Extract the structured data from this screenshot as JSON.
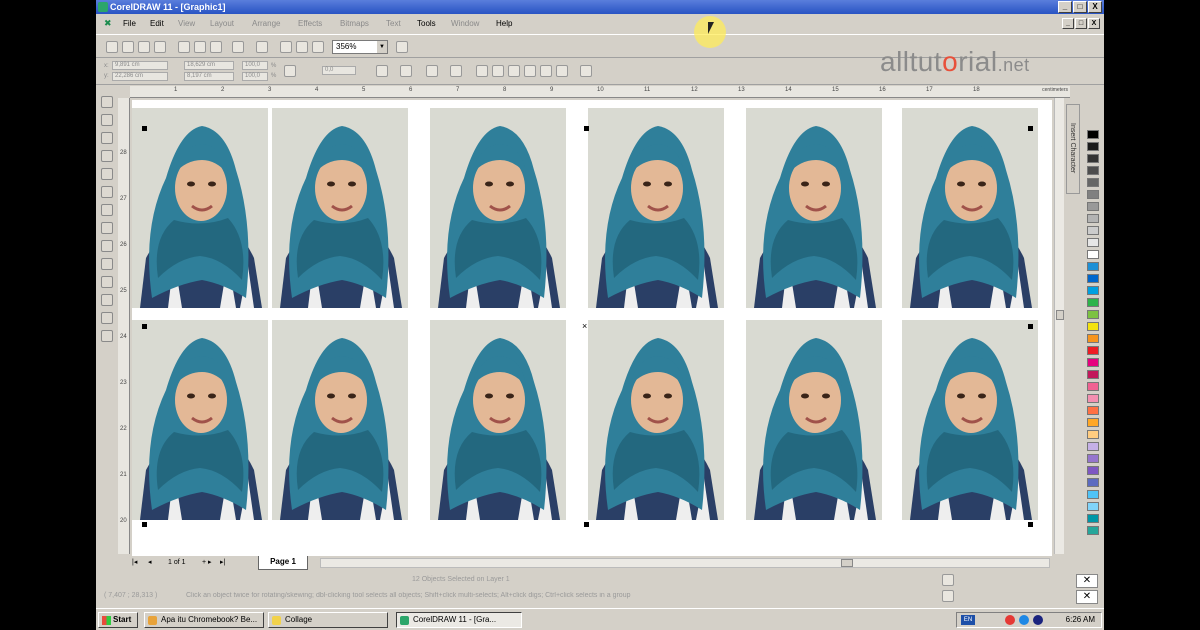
{
  "window": {
    "title": "CorelDRAW 11 - [Graphic1]",
    "minimize_glyph": "_",
    "maximize_glyph": "□",
    "close_glyph": "X"
  },
  "menu": {
    "items": [
      {
        "label": "File",
        "enabled": true
      },
      {
        "label": "Edit",
        "enabled": true
      },
      {
        "label": "View",
        "enabled": false
      },
      {
        "label": "Layout",
        "enabled": false
      },
      {
        "label": "Arrange",
        "enabled": false
      },
      {
        "label": "Effects",
        "enabled": false
      },
      {
        "label": "Bitmaps",
        "enabled": false
      },
      {
        "label": "Text",
        "enabled": false
      },
      {
        "label": "Tools",
        "enabled": true
      },
      {
        "label": "Window",
        "enabled": false
      },
      {
        "label": "Help",
        "enabled": true
      }
    ]
  },
  "toolbar": {
    "zoom_level": "356%",
    "zoom_drop_glyph": "▼"
  },
  "property_bar": {
    "x_label": "x:",
    "x_value": "9,891 cm",
    "y_label": "y:",
    "y_value": "22,286 cm",
    "width_value": "18,629 cm",
    "height_value": "8,197 cm",
    "scale_x": "100,0",
    "scale_y": "100,0",
    "pct_sign": "%",
    "rotation": "0,0"
  },
  "logo": {
    "part1": "alltut",
    "highlight": "o",
    "part2": "rial",
    "tld": ".net"
  },
  "ruler": {
    "unit_label": "centimeters",
    "h_numbers": [
      "1",
      "2",
      "3",
      "4",
      "5",
      "6",
      "7",
      "8",
      "9",
      "10",
      "11",
      "12",
      "13",
      "14",
      "15",
      "16",
      "17",
      "18"
    ],
    "v_numbers": [
      "28",
      "27",
      "26",
      "25",
      "24",
      "23",
      "22",
      "21",
      "20"
    ]
  },
  "docker": {
    "label": "Insert Character"
  },
  "palette": {
    "colors": [
      "#000000",
      "#1a1a1a",
      "#333333",
      "#4d4d4d",
      "#666666",
      "#808080",
      "#999999",
      "#b3b3b3",
      "#cccccc",
      "#e6e6e6",
      "#ffffff",
      "#1e90d6",
      "#0066cc",
      "#00a0e0",
      "#2db34a",
      "#7dc242",
      "#f4e20f",
      "#f7941d",
      "#ed1c24",
      "#e6007e",
      "#c2185b",
      "#f06292",
      "#f48fb1",
      "#ff7043",
      "#ffa726",
      "#ffcc80",
      "#c5b0e6",
      "#9575cd",
      "#7e57c2",
      "#5c6bc0",
      "#4fc3f7",
      "#81d4fa",
      "#0097a7",
      "#26a69a"
    ]
  },
  "page_nav": {
    "first_glyph": "|◂",
    "prev_glyph": "◂",
    "counter": "1 of 1",
    "next_glyph": "▸",
    "last_glyph": "▸|",
    "add_glyph": "+",
    "tab_label": "Page 1"
  },
  "status": {
    "selection_info": "12 Objects Selected on Layer 1",
    "cursor_coords": "( 7,407 ; 28,313 )",
    "hint": "Click an object twice for rotating/skewing; dbl-clicking tool selects all objects; Shift+click multi-selects; Alt+click digs; Ctrl+click selects in a group"
  },
  "taskbar": {
    "start_label": "Start",
    "tasks": [
      {
        "label": "Apa itu Chromebook? Be...",
        "active": false,
        "color": "#e8a33a"
      },
      {
        "label": "Collage",
        "active": false,
        "color": "#f2d24a"
      },
      {
        "label": "CorelDRAW 11 - [Gra...",
        "active": true,
        "color": "#2ca66a"
      }
    ],
    "language": "EN",
    "clock": "6:26 AM"
  },
  "photos": {
    "rows": 2,
    "cols": 6
  }
}
